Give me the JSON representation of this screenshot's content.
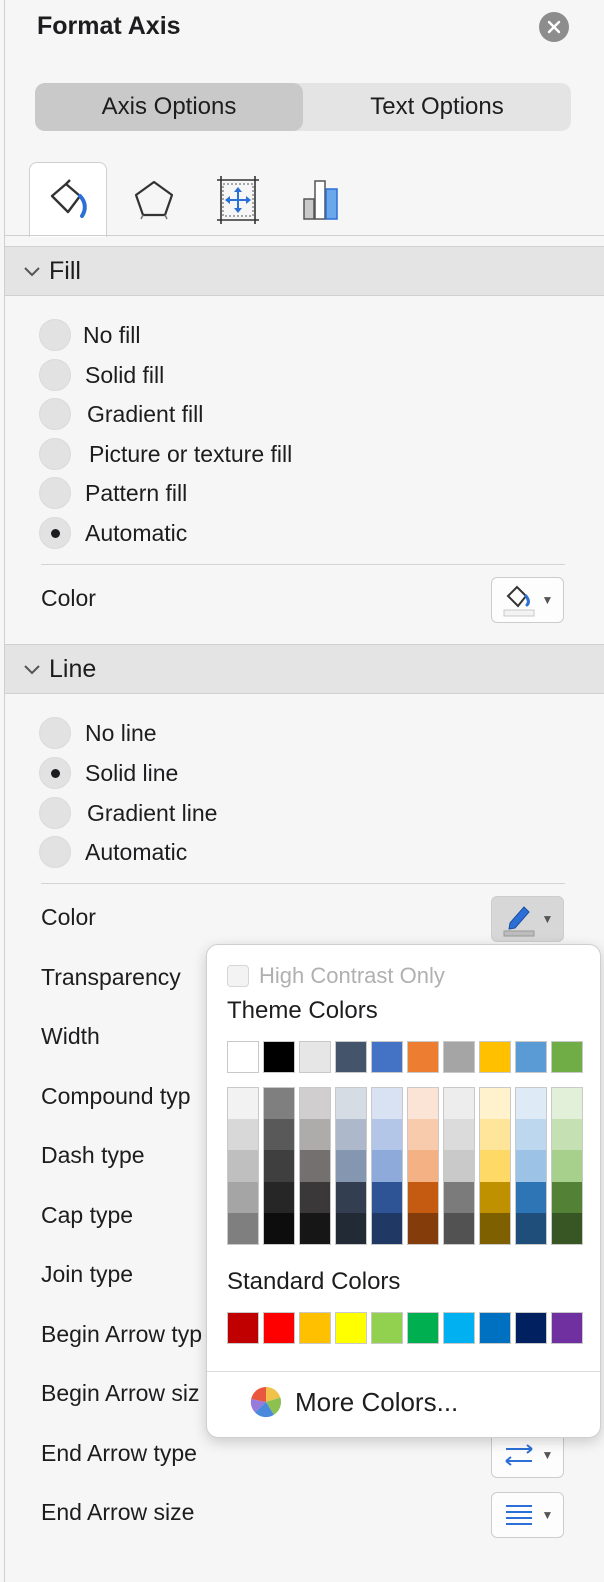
{
  "panel": {
    "title": "Format Axis",
    "tabs": [
      "Axis Options",
      "Text Options"
    ],
    "icon_tabs": [
      "fill-line-icon",
      "effects-icon",
      "size-properties-icon",
      "axis-options-icon"
    ]
  },
  "fill": {
    "header": "Fill",
    "options": [
      "No fill",
      "Solid fill",
      "Gradient fill",
      "Picture or texture fill",
      "Pattern fill",
      "Automatic"
    ],
    "selected": "Automatic",
    "color_label": "Color"
  },
  "line": {
    "header": "Line",
    "options": [
      "No line",
      "Solid line",
      "Gradient line",
      "Automatic"
    ],
    "selected": "Solid line",
    "props": [
      "Color",
      "Transparency",
      "Width",
      "Compound typ",
      "Dash type",
      "Cap type",
      "Join type",
      "Begin Arrow typ",
      "Begin Arrow siz",
      "End Arrow type",
      "End Arrow size"
    ]
  },
  "color_popup": {
    "high_contrast_label": "High Contrast Only",
    "theme_header": "Theme Colors",
    "theme_colors": [
      "#ffffff",
      "#000000",
      "#e7e6e6",
      "#44546a",
      "#4472c4",
      "#ed7d31",
      "#a5a5a5",
      "#ffc000",
      "#5b9bd5",
      "#70ad47"
    ],
    "theme_shades": [
      [
        "#f2f2f2",
        "#d8d8d8",
        "#bfbfbf",
        "#a5a5a5",
        "#7f7f7f"
      ],
      [
        "#7f7f7f",
        "#595959",
        "#3f3f3f",
        "#262626",
        "#0d0d0d"
      ],
      [
        "#d0cece",
        "#aeabab",
        "#757070",
        "#3a3838",
        "#171616"
      ],
      [
        "#d6dce4",
        "#adb9ca",
        "#8496b0",
        "#333f50",
        "#222a35"
      ],
      [
        "#d9e2f3",
        "#b4c6e7",
        "#8eaadb",
        "#2f5496",
        "#1f3864"
      ],
      [
        "#fbe4d5",
        "#f7cbac",
        "#f4b183",
        "#c55a11",
        "#843c0b"
      ],
      [
        "#ededed",
        "#dbdbdb",
        "#c9c9c9",
        "#7b7b7b",
        "#525252"
      ],
      [
        "#fff2cc",
        "#fee599",
        "#ffd965",
        "#bf9000",
        "#7f6000"
      ],
      [
        "#deebf6",
        "#bdd7ee",
        "#9cc3e5",
        "#2e75b5",
        "#1e4e79"
      ],
      [
        "#e2efd9",
        "#c5e0b3",
        "#a8d08d",
        "#538135",
        "#375623"
      ]
    ],
    "standard_header": "Standard Colors",
    "standard_colors": [
      "#c00000",
      "#ff0000",
      "#ffc000",
      "#ffff00",
      "#92d050",
      "#00b050",
      "#00b0f0",
      "#0070c0",
      "#002060",
      "#7030a0"
    ],
    "more_colors_label": "More Colors..."
  }
}
